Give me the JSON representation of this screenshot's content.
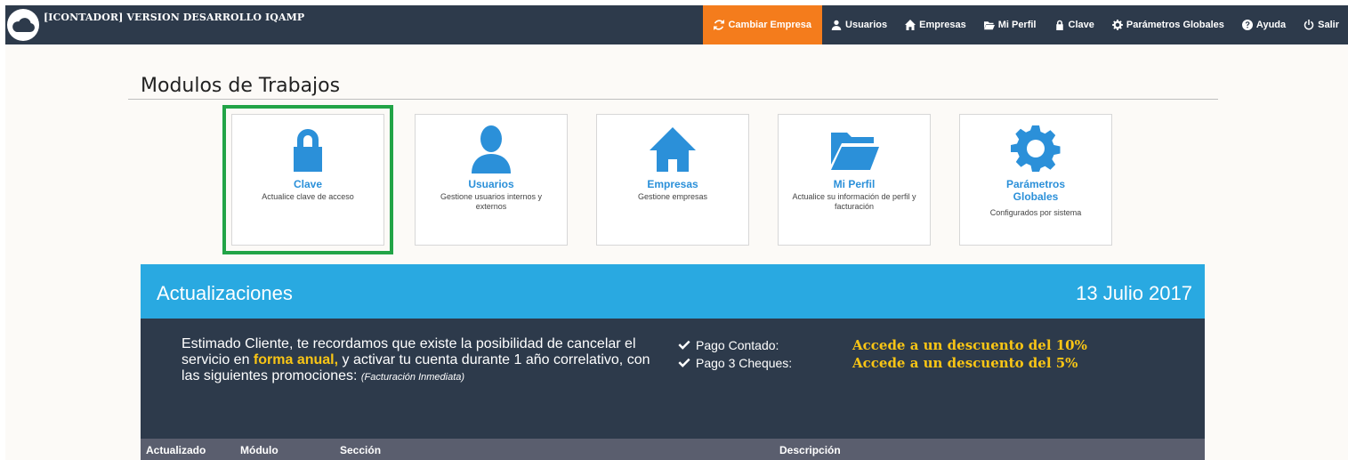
{
  "app": {
    "title": "[ICONTADOR] VERSION DESARROLLO IQAMP",
    "logo_icon": "cloud-icon"
  },
  "nav": [
    {
      "label": "Cambiar Empresa",
      "icon": "refresh-icon",
      "active": true
    },
    {
      "label": "Usuarios",
      "icon": "user-icon"
    },
    {
      "label": "Empresas",
      "icon": "home-icon"
    },
    {
      "label": "Mi Perfil",
      "icon": "folder-open-icon"
    },
    {
      "label": "Clave",
      "icon": "lock-icon"
    },
    {
      "label": "Parámetros Globales",
      "icon": "gear-icon"
    },
    {
      "label": "Ayuda",
      "icon": "question-circle-icon"
    },
    {
      "label": "Salir",
      "icon": "power-icon"
    }
  ],
  "page_title": "Modulos de Trabajos",
  "modules": [
    {
      "title": "Clave",
      "description": "Actualice clave de acceso",
      "icon": "lock-icon",
      "selected": true
    },
    {
      "title": "Usuarios",
      "description": "Gestione usuarios internos y externos",
      "icon": "user-icon"
    },
    {
      "title": "Empresas",
      "description": "Gestione empresas",
      "icon": "home-icon"
    },
    {
      "title": "Mi Perfil",
      "description": "Actualice su información de perfil y facturación",
      "icon": "folder-open-icon"
    },
    {
      "title": "Parámetros Globales",
      "description": "Configurados por sistema",
      "icon": "gear-icon"
    }
  ],
  "updates": {
    "title": "Actualizaciones",
    "date": "13 Julio 2017",
    "message_part1": "Estimado Cliente, te recordamos que existe la posibilidad de cancelar el servicio en ",
    "message_highlight": "forma anual,",
    "message_part2": " y activar tu cuenta durante 1 año correlativo, con las siguientes promociones: ",
    "message_note": "(Facturación Inmediata)",
    "promotions": [
      {
        "label": "Pago Contado:",
        "value": "Accede a un descuento del 10%"
      },
      {
        "label": "Pago 3 Cheques:",
        "value": "Accede a un descuento del 5%"
      }
    ]
  },
  "table": {
    "columns": [
      "Actualizado",
      "Módulo",
      "Sección",
      "Descripción"
    ]
  },
  "colors": {
    "navbar": "#2d3a4b",
    "active_nav": "#f47c1c",
    "accent_blue": "#2b90d9",
    "updates_header": "#29a9e1",
    "highlight_yellow": "#f9c515",
    "selection_green": "#22a447"
  }
}
